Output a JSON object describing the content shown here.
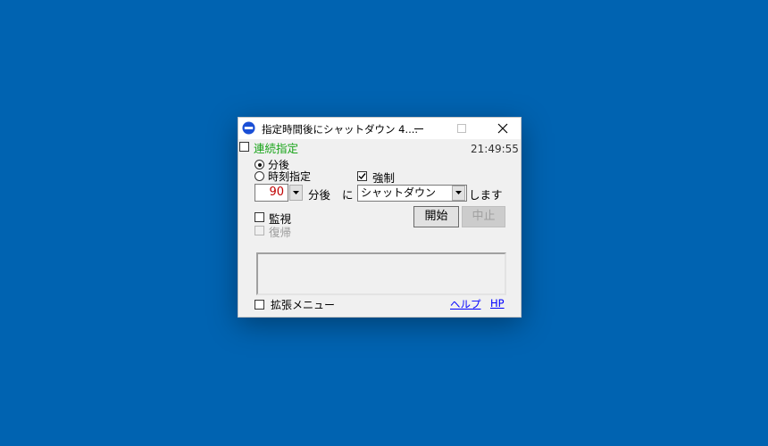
{
  "window": {
    "title": "指定時間後にシャットダウン 4....",
    "clock": "21:49:55"
  },
  "options": {
    "continuous_label": "連続指定",
    "after_minutes_label": "分後",
    "at_time_label": "時刻指定",
    "force_label": "強制",
    "force_checked": true,
    "monitor_label": "監視",
    "restore_label": "復帰"
  },
  "schedule": {
    "minutes_value": "90",
    "minutes_unit": "分後",
    "connector": "に",
    "action_value": "シャットダウン",
    "suffix": "します"
  },
  "buttons": {
    "start_label": "開始",
    "stop_label": "中止"
  },
  "footer": {
    "extended_menu_label": "拡張メニュー",
    "help_link": "ヘルプ",
    "hp_link": "HP"
  }
}
